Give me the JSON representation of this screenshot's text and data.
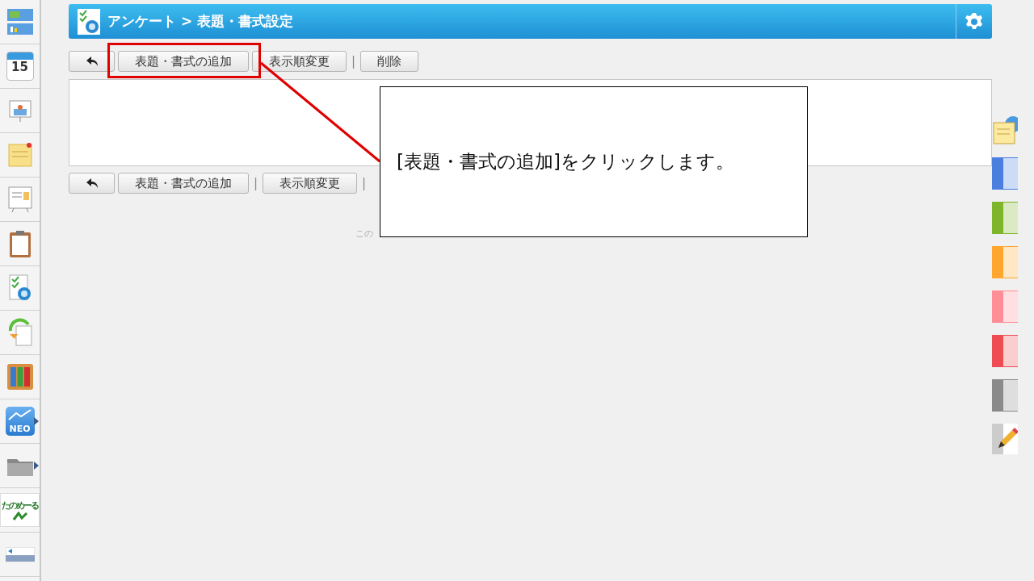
{
  "sidebar": {
    "items": [
      {
        "kind": "dashboard",
        "has_submenu": false
      },
      {
        "kind": "calendar",
        "text": "15",
        "has_submenu": false
      },
      {
        "kind": "board",
        "has_submenu": false
      },
      {
        "kind": "memo",
        "has_submenu": false
      },
      {
        "kind": "notice",
        "has_submenu": false
      },
      {
        "kind": "clipboard",
        "has_submenu": false
      },
      {
        "kind": "survey",
        "has_submenu": false
      },
      {
        "kind": "sync",
        "has_submenu": false
      },
      {
        "kind": "binders",
        "has_submenu": false
      },
      {
        "kind": "neo",
        "text": "NEO",
        "has_submenu": true
      },
      {
        "kind": "folder",
        "has_submenu": true
      },
      {
        "kind": "banner",
        "text": "たのめーる",
        "has_submenu": false
      },
      {
        "kind": "banner2",
        "has_submenu": false
      }
    ]
  },
  "header": {
    "title": "アンケート > 表題・書式設定"
  },
  "top_toolbar": [
    {
      "kind": "back"
    },
    {
      "kind": "button",
      "label": "表題・書式の追加"
    },
    {
      "kind": "button",
      "label": "表示順変更"
    },
    {
      "kind": "separator",
      "label": "|"
    },
    {
      "kind": "button",
      "label": "削除"
    }
  ],
  "bottom_toolbar": [
    {
      "kind": "back"
    },
    {
      "kind": "button",
      "label": "表題・書式の追加"
    },
    {
      "kind": "separator",
      "label": "|"
    },
    {
      "kind": "button",
      "label": "表示順変更"
    },
    {
      "kind": "separator",
      "label": "|"
    }
  ],
  "footer": {
    "text": "この"
  },
  "callout": {
    "text": "[表題・書式の追加]をクリックします。"
  },
  "palette": [
    {
      "kind": "note"
    },
    {
      "kind": "color",
      "color": "#4a7fe0"
    },
    {
      "kind": "color",
      "color": "#7fb52a"
    },
    {
      "kind": "color",
      "color": "#ffa62e"
    },
    {
      "kind": "color",
      "color": "#ff8e96"
    },
    {
      "kind": "color",
      "color": "#ec4c52"
    },
    {
      "kind": "color",
      "color": "#8a8a8a"
    },
    {
      "kind": "pencil"
    }
  ]
}
